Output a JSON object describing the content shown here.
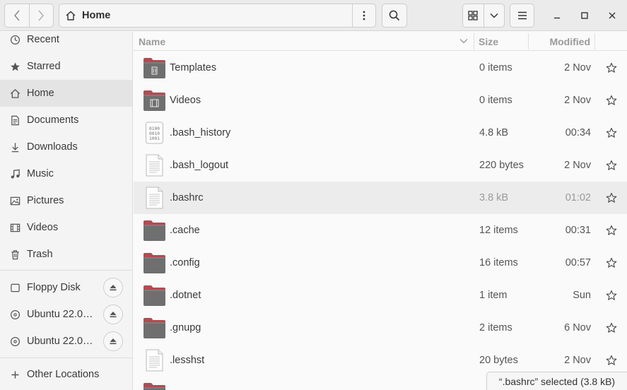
{
  "location": {
    "title": "Home"
  },
  "sidebar": {
    "places": [
      {
        "label": "Recent",
        "icon": "clock-icon"
      },
      {
        "label": "Starred",
        "icon": "star-icon"
      },
      {
        "label": "Home",
        "icon": "home-icon"
      },
      {
        "label": "Documents",
        "icon": "document-icon"
      },
      {
        "label": "Downloads",
        "icon": "download-icon"
      },
      {
        "label": "Music",
        "icon": "music-icon"
      },
      {
        "label": "Pictures",
        "icon": "picture-icon"
      },
      {
        "label": "Videos",
        "icon": "video-icon"
      },
      {
        "label": "Trash",
        "icon": "trash-icon"
      }
    ],
    "devices": [
      {
        "label": "Floppy Disk",
        "icon": "drive-icon"
      },
      {
        "label": "Ubuntu 22.0…",
        "icon": "disc-icon"
      },
      {
        "label": "Ubuntu 22.0…",
        "icon": "disc-icon"
      }
    ],
    "other_locations": "Other Locations"
  },
  "columns": {
    "name": "Name",
    "size": "Size",
    "modified": "Modified"
  },
  "files": [
    {
      "name": "Templates",
      "size": "0 items",
      "modified": "2 Nov",
      "type": "folder-templates"
    },
    {
      "name": "Videos",
      "size": "0 items",
      "modified": "2 Nov",
      "type": "folder-videos"
    },
    {
      "name": ".bash_history",
      "size": "4.8 kB",
      "modified": "00:34",
      "type": "binary"
    },
    {
      "name": ".bash_logout",
      "size": "220 bytes",
      "modified": "2 Nov",
      "type": "text"
    },
    {
      "name": ".bashrc",
      "size": "3.8 kB",
      "modified": "01:02",
      "type": "text"
    },
    {
      "name": ".cache",
      "size": "12 items",
      "modified": "00:31",
      "type": "folder"
    },
    {
      "name": ".config",
      "size": "16 items",
      "modified": "00:57",
      "type": "folder"
    },
    {
      "name": ".dotnet",
      "size": "1 item",
      "modified": "Sun",
      "type": "folder"
    },
    {
      "name": ".gnupg",
      "size": "2 items",
      "modified": "6 Nov",
      "type": "folder"
    },
    {
      "name": ".lesshst",
      "size": "20 bytes",
      "modified": "2 Nov",
      "type": "text"
    }
  ],
  "selected_row": ".bashrc",
  "status": "“.bashrc” selected  (3.8 kB)",
  "binary_glyph": [
    "0100",
    "0010",
    "1001"
  ],
  "colors": {
    "folder_tab": "#b34a52",
    "folder_body": "#6f6f6f",
    "selection": "#ececec"
  }
}
